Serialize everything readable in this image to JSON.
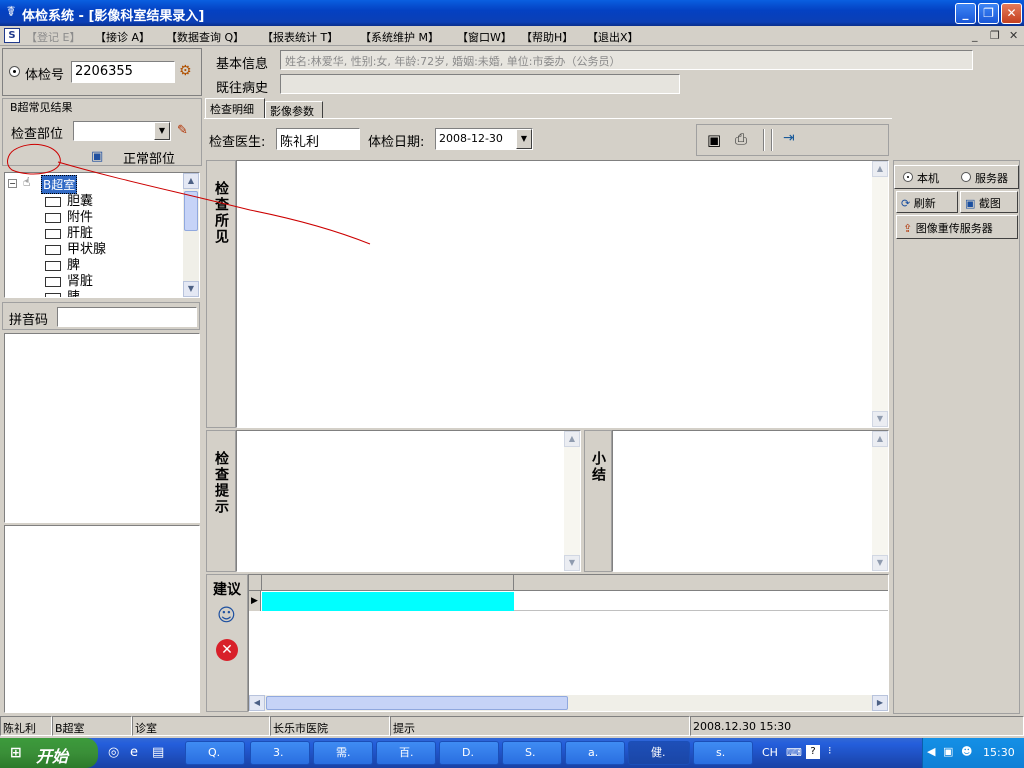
{
  "window": {
    "title": "体检系统 - [影像科室结果录入]",
    "icon": "app-logo-icon"
  },
  "menu": [
    {
      "label": "【登记 E】",
      "disabled": true
    },
    {
      "label": "【接诊 A】"
    },
    {
      "label": "【数据查询 Q】"
    },
    {
      "label": "【报表统计 T】"
    },
    {
      "label": "【系统维护 M】"
    },
    {
      "label": "【窗口W】"
    },
    {
      "label": "【帮助H】"
    },
    {
      "label": "【退出X】"
    }
  ],
  "patient": {
    "id_label": "体检号",
    "id_value": "2206355",
    "basic_label": "基本信息",
    "basic_value": "姓名:林爱华, 性别:女, 年龄:72岁, 婚姻:未婚, 单位:市委办（公务员）",
    "history_label": "既往病史",
    "history_value": ""
  },
  "left_panel": {
    "group_title": "B超常见结果",
    "part_label": "检查部位",
    "normal_part_label": "正常部位",
    "tree_root": "B超室",
    "tree_items": [
      "胆囊",
      "附件",
      "肝脏",
      "甲状腺",
      "脾",
      "肾脏",
      "胰"
    ],
    "pinyin_label": "拼音码",
    "pinyin_value": ""
  },
  "tabs": [
    "检查明细",
    "影像参数"
  ],
  "exam": {
    "doctor_label": "检查医生:",
    "doctor_value": "陈礼利",
    "date_label": "体检日期:",
    "date_value": "2008-12-30",
    "findings_label": "检查所见",
    "hint_label": "检查提示",
    "summary_label": "小结",
    "advice_label": "建议"
  },
  "right_panel": {
    "radio_local": "本机",
    "radio_server": "服务器",
    "refresh_label": "刷新",
    "capture_label": "截图",
    "reupload_label": "图像重传服务器"
  },
  "statusbar": [
    "陈礼利",
    "B超室",
    "诊室",
    "长乐市医院",
    "提示",
    "2008.12.30 15:30"
  ],
  "taskbar": {
    "start_label": "开始",
    "tasks": [
      "Q.",
      "3.",
      "需.",
      "百.",
      "D.",
      "S.",
      "a.",
      "健.",
      "s."
    ],
    "tray_lang": "CH",
    "clock": "15:30"
  },
  "colors": {
    "grid_highlight": "#00ffff",
    "annotation_red": "#cc0000"
  }
}
